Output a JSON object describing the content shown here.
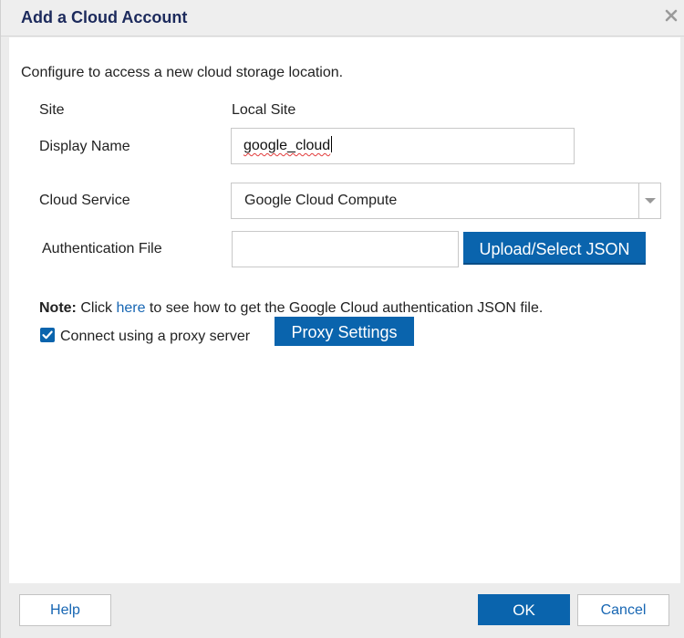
{
  "dialog": {
    "title": "Add a Cloud Account",
    "description": "Configure to access a new cloud storage location."
  },
  "form": {
    "site_label": "Site",
    "site_value": "Local Site",
    "display_name_label": "Display Name",
    "display_name_value": "google_cloud",
    "cloud_service_label": "Cloud Service",
    "cloud_service_value": "Google Cloud Compute",
    "auth_file_label": "Authentication File",
    "auth_file_value": "",
    "upload_button": "Upload/Select JSON"
  },
  "note": {
    "prefix": "Note:",
    "text_before_link": " Click ",
    "link": "here",
    "text_after_link": " to see how to get the Google Cloud authentication JSON file."
  },
  "proxy": {
    "checkbox_label": "Connect using a proxy server",
    "checked": true,
    "settings_button": "Proxy Settings"
  },
  "footer": {
    "help": "Help",
    "ok": "OK",
    "cancel": "Cancel"
  },
  "colors": {
    "accent": "#0a64ad",
    "title": "#1c2a5c",
    "link": "#1766b3"
  }
}
